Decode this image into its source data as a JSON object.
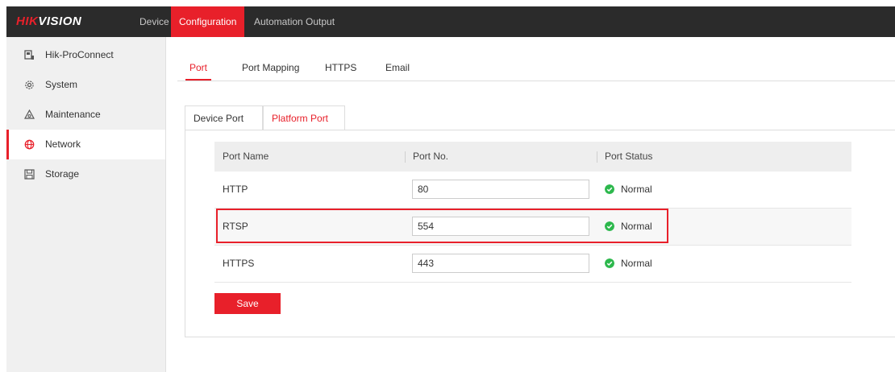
{
  "brand": {
    "logo_prefix": "HIK",
    "logo_suffix": "VISION",
    "accent_color": "#e8202a"
  },
  "topnav": {
    "items": [
      {
        "label": "Device"
      },
      {
        "label": "Configuration",
        "active": true
      },
      {
        "label": "Automation Output"
      }
    ]
  },
  "sidebar": {
    "items": [
      {
        "label": "Hik-ProConnect",
        "icon": "device-icon"
      },
      {
        "label": "System",
        "icon": "gear-icon"
      },
      {
        "label": "Maintenance",
        "icon": "maintenance-icon"
      },
      {
        "label": "Network",
        "icon": "globe-icon",
        "active": true
      },
      {
        "label": "Storage",
        "icon": "storage-icon"
      }
    ]
  },
  "tabs": [
    {
      "label": "Port",
      "active": true
    },
    {
      "label": "Port Mapping"
    },
    {
      "label": "HTTPS"
    },
    {
      "label": "Email"
    }
  ],
  "subtabs": [
    {
      "label": "Device Port"
    },
    {
      "label": "Platform Port",
      "active": true
    }
  ],
  "table": {
    "headers": [
      "Port Name",
      "Port No.",
      "Port Status"
    ],
    "rows": [
      {
        "name": "HTTP",
        "port": "80",
        "status": "Normal"
      },
      {
        "name": "RTSP",
        "port": "554",
        "status": "Normal",
        "highlighted": true
      },
      {
        "name": "HTTPS",
        "port": "443",
        "status": "Normal"
      }
    ],
    "status_color": "#2db84d"
  },
  "actions": {
    "save_label": "Save"
  }
}
